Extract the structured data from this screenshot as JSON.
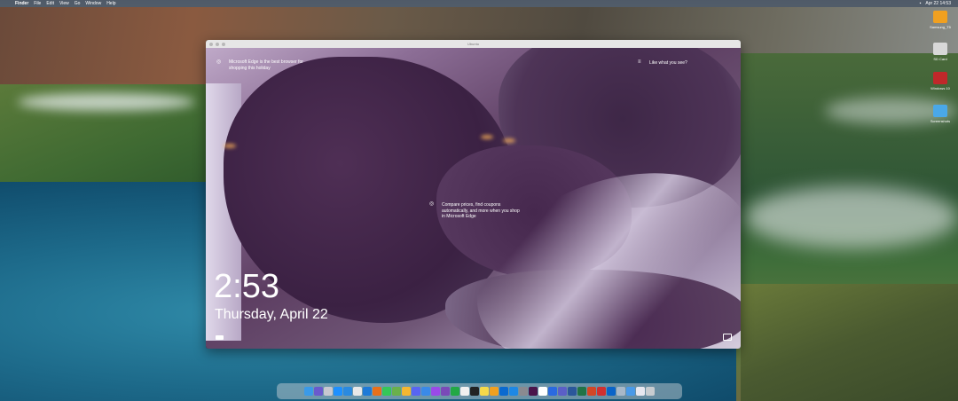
{
  "menubar": {
    "app_name": "Finder",
    "menus": [
      "File",
      "Edit",
      "View",
      "Go",
      "Window",
      "Help"
    ],
    "clock": "Apr 22  14:53"
  },
  "desktop_icons": [
    {
      "label": "Samsung_T5",
      "color": "#f0a020",
      "name": "samsung-t5-drive"
    },
    {
      "label": "SD Card",
      "color": "#d8d8d8",
      "name": "sd-card-drive"
    },
    {
      "label": "Windows 10",
      "color": "#c0282a",
      "name": "windows-10-vm"
    },
    {
      "label": "Screenshots",
      "color": "#4aa8e8",
      "name": "screenshots-folder"
    }
  ],
  "window": {
    "title": "Ubuntu"
  },
  "lockscreen": {
    "tip_top_left": "Microsoft Edge is the best browser for shopping this holiday",
    "tip_top_right": "Like what you see?",
    "tip_center": "Compare prices, find coupons automatically, and more when you shop in Microsoft Edge",
    "time": "2:53",
    "date": "Thursday, April 22"
  },
  "dock_apps": [
    {
      "name": "finder",
      "color": "#3a9ae8"
    },
    {
      "name": "siri",
      "color": "#6a5acd"
    },
    {
      "name": "launchpad",
      "color": "#c8c8d0"
    },
    {
      "name": "app-store",
      "color": "#1e90ff"
    },
    {
      "name": "safari",
      "color": "#2a8ae0"
    },
    {
      "name": "chrome",
      "color": "#e8e8e8"
    },
    {
      "name": "edge",
      "color": "#1e7ad8"
    },
    {
      "name": "firefox",
      "color": "#e8701a"
    },
    {
      "name": "messages",
      "color": "#34c759"
    },
    {
      "name": "maps",
      "color": "#6ab04c"
    },
    {
      "name": "photos",
      "color": "#f5b731"
    },
    {
      "name": "discord",
      "color": "#5865f2"
    },
    {
      "name": "mail",
      "color": "#3a8ae8"
    },
    {
      "name": "messenger",
      "color": "#9a4ae8"
    },
    {
      "name": "ticktick",
      "color": "#7a4ab8"
    },
    {
      "name": "numbers",
      "color": "#22a845"
    },
    {
      "name": "notion",
      "color": "#f0f0f0"
    },
    {
      "name": "terminal",
      "color": "#222222"
    },
    {
      "name": "notes",
      "color": "#f5d94a"
    },
    {
      "name": "pages",
      "color": "#f0a020"
    },
    {
      "name": "outlook",
      "color": "#0a6ad0"
    },
    {
      "name": "onedrive",
      "color": "#1e88e5"
    },
    {
      "name": "system-preferences",
      "color": "#8a8a90"
    },
    {
      "name": "slack",
      "color": "#4a154b"
    },
    {
      "name": "calendar",
      "color": "#ffffff"
    },
    {
      "name": "todo",
      "color": "#2a6ae0"
    },
    {
      "name": "teams",
      "color": "#5b5fc7"
    },
    {
      "name": "word",
      "color": "#2b579a"
    },
    {
      "name": "excel",
      "color": "#217346"
    },
    {
      "name": "powerpoint",
      "color": "#d24726"
    },
    {
      "name": "parallels",
      "color": "#d03030"
    },
    {
      "name": "vm-windows",
      "color": "#0a64c8"
    },
    {
      "name": "preview",
      "color": "#a8b8c8"
    },
    {
      "name": "downloads",
      "color": "#4a9ae8"
    },
    {
      "name": "documents",
      "color": "#e8e8f0"
    },
    {
      "name": "trash",
      "color": "#c8ccd0"
    }
  ]
}
